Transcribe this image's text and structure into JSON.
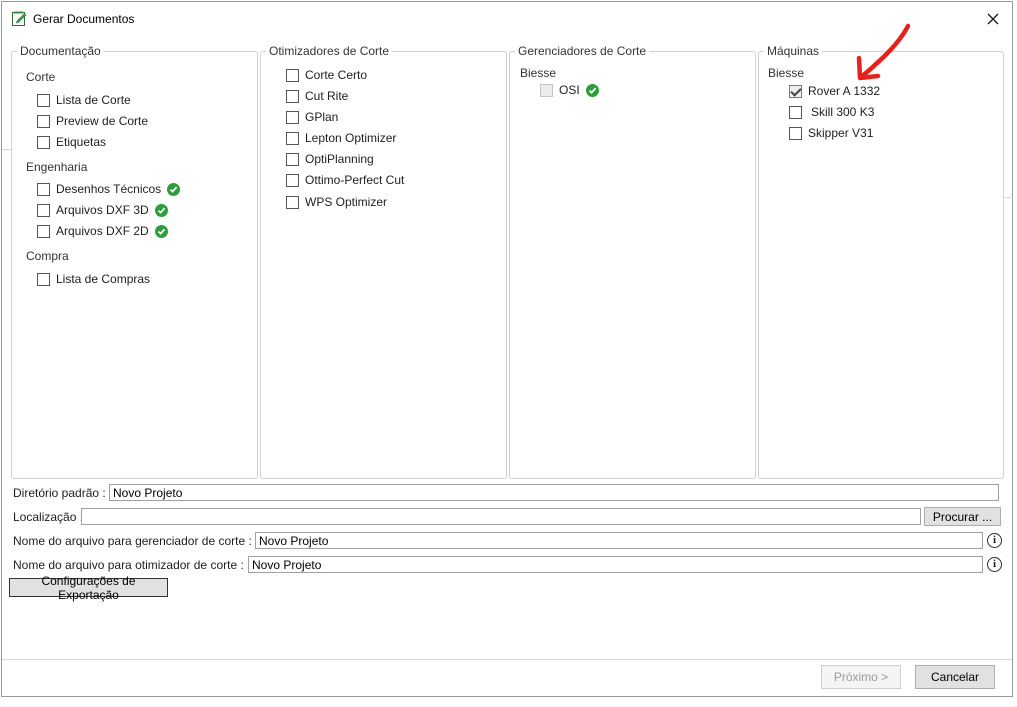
{
  "window": {
    "title": "Gerar Documentos",
    "icon": "document-edit-icon"
  },
  "panels": {
    "documentacao": {
      "legend": "Documentação",
      "groups": [
        {
          "label": "Corte",
          "items": [
            {
              "label": "Lista de Corte",
              "checked": false
            },
            {
              "label": "Preview de Corte",
              "checked": false
            },
            {
              "label": "Etiquetas",
              "checked": false
            }
          ]
        },
        {
          "label": "Engenharia",
          "items": [
            {
              "label": "Desenhos Técnicos",
              "checked": false,
              "status": "ok"
            },
            {
              "label": "Arquivos DXF 3D",
              "checked": false,
              "status": "ok"
            },
            {
              "label": "Arquivos DXF 2D",
              "checked": false,
              "status": "ok"
            }
          ]
        },
        {
          "label": "Compra",
          "items": [
            {
              "label": "Lista de Compras",
              "checked": false
            }
          ]
        }
      ]
    },
    "otimizadores": {
      "legend": "Otimizadores de Corte",
      "items": [
        {
          "label": "Corte Certo",
          "checked": false
        },
        {
          "label": "Cut Rite",
          "checked": false
        },
        {
          "label": "GPlan",
          "checked": false
        },
        {
          "label": "Lepton Optimizer",
          "checked": false
        },
        {
          "label": "OptiPlanning",
          "checked": false
        },
        {
          "label": "Ottimo-Perfect Cut",
          "checked": false
        },
        {
          "label": "WPS Optimizer",
          "checked": false
        }
      ]
    },
    "gerenciadores": {
      "legend": "Gerenciadores de Corte",
      "group": "Biesse",
      "items": [
        {
          "label": "OSI",
          "checked": false,
          "disabled": true,
          "status": "ok"
        }
      ]
    },
    "maquinas": {
      "legend": "Máquinas",
      "group": "Biesse",
      "items": [
        {
          "label": "Rover A 1332",
          "checked": true
        },
        {
          "label": "Skill 300 K3",
          "checked": false
        },
        {
          "label": "Skipper V31",
          "checked": false
        }
      ]
    }
  },
  "fields": {
    "diretorio": {
      "label": "Diretório padrão :",
      "value": "Novo Projeto"
    },
    "localizacao": {
      "label": "Localização :",
      "value": "",
      "browse_label": "Procurar ..."
    },
    "arquivo_gerenciador": {
      "label": "Nome do arquivo para gerenciador de corte :",
      "value": "Novo Projeto"
    },
    "arquivo_otimizador": {
      "label": "Nome do arquivo para otimizador de corte :",
      "value": "Novo Projeto"
    }
  },
  "buttons": {
    "export_config": "Configurações de Exportação",
    "next": "Próximo >",
    "cancel": "Cancelar"
  },
  "colors": {
    "ok_badge": "#2e9e3a",
    "annotation_arrow": "#e8201c"
  }
}
